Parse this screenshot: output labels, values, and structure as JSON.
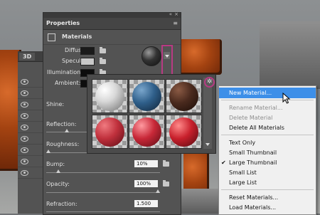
{
  "panel3d": {
    "tab_label": "3D"
  },
  "properties": {
    "tab_label": "Properties",
    "section_title": "Materials",
    "labels": {
      "diffuse": "Diffuse:",
      "specular": "Specular:",
      "illumination": "Illumination:",
      "ambient": "Ambient:",
      "shine": "Shine:",
      "reflection": "Reflection:",
      "roughness": "Roughness:",
      "bump": "Bump:",
      "opacity": "Opacity:",
      "refraction": "Refraction:"
    },
    "values": {
      "bump": "10%",
      "opacity": "100%",
      "refraction": "1.500"
    },
    "swatch_colors": {
      "diffuse": "#1a1a1a",
      "specular": "#c8c8c8",
      "illumination": "#0d0d0d",
      "ambient": "#0d0d0d"
    }
  },
  "picker": {
    "materials": [
      {
        "color": "#e6e6e6"
      },
      {
        "color": "#2f5f8a"
      },
      {
        "color": "#4a2a1e"
      },
      {
        "color": "#c0303c"
      },
      {
        "color": "#c82838"
      },
      {
        "color": "#c8202c"
      }
    ]
  },
  "menu": {
    "items": [
      {
        "label": "New Material...",
        "state": "highlighted"
      },
      {
        "label": "Rename Material...",
        "state": "disabled"
      },
      {
        "label": "Delete Material",
        "state": "disabled"
      },
      {
        "label": "Delete All Materials",
        "state": "normal"
      },
      {
        "label": "Text Only",
        "state": "normal"
      },
      {
        "label": "Small Thumbnail",
        "state": "normal"
      },
      {
        "label": "Large Thumbnail",
        "state": "checked"
      },
      {
        "label": "Small List",
        "state": "normal"
      },
      {
        "label": "Large List",
        "state": "normal"
      },
      {
        "label": "Reset Materials...",
        "state": "normal"
      },
      {
        "label": "Load Materials...",
        "state": "normal"
      }
    ]
  },
  "icons": {
    "gear": "gear-icon",
    "cursor": "cursor-arrow-icon",
    "check": "checkmark-icon",
    "folder": "folder-icon",
    "materials": "materials-icon"
  }
}
